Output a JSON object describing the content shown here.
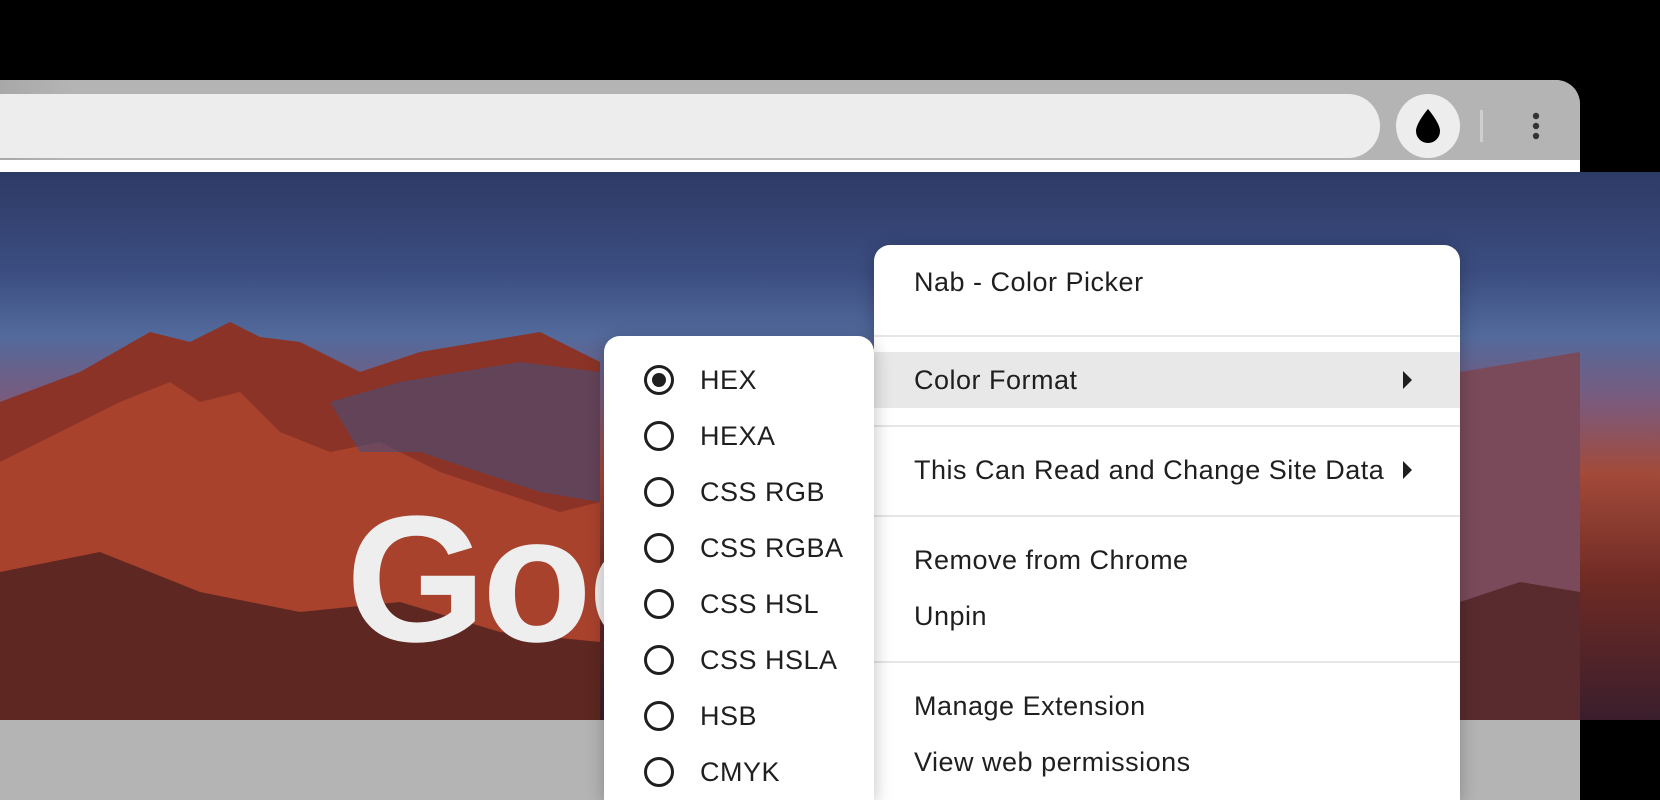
{
  "browser": {
    "extension_button_icon": "eyedropper-drop-icon",
    "more_menu_icon": "kebab-menu-icon"
  },
  "page": {
    "logo_text_visible": "Goo"
  },
  "context_menu": {
    "title": "Nab - Color Picker",
    "color_format_label": "Color Format",
    "site_data_label": "This Can Read and Change Site Data",
    "remove_label": "Remove from Chrome",
    "unpin_label": "Unpin",
    "manage_label": "Manage Extension",
    "permissions_label": "View web permissions"
  },
  "color_format_submenu": {
    "selected": "HEX",
    "options": [
      "HEX",
      "HEXA",
      "CSS RGB",
      "CSS RGBA",
      "CSS HSL",
      "CSS HSLA",
      "HSB",
      "CMYK"
    ]
  }
}
